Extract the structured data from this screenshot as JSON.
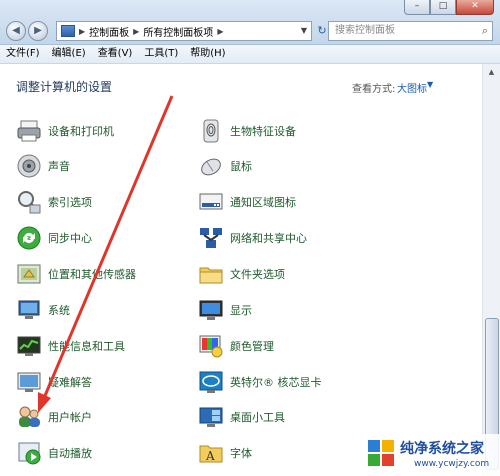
{
  "address_bar": {
    "crumbs": [
      "控制面板",
      "所有控制面板项"
    ],
    "search_placeholder": "搜索控制面板"
  },
  "window_buttons": {
    "minimize": "–",
    "maximize": "□",
    "close": "✕"
  },
  "menu": {
    "file": "文件(F)",
    "edit": "编辑(E)",
    "view": "查看(V)",
    "tools": "工具(T)",
    "help": "帮助(H)"
  },
  "header": {
    "title": "调整计算机的设置",
    "view_by_label": "查看方式:",
    "view_by_value": "大图标"
  },
  "items_left": [
    {
      "label": "设备和打印机",
      "icon": "printer-icon"
    },
    {
      "label": "声音",
      "icon": "speaker-icon"
    },
    {
      "label": "索引选项",
      "icon": "index-icon"
    },
    {
      "label": "同步中心",
      "icon": "sync-icon"
    },
    {
      "label": "位置和其他传感器",
      "icon": "sensor-icon"
    },
    {
      "label": "系统",
      "icon": "system-icon"
    },
    {
      "label": "性能信息和工具",
      "icon": "performance-icon"
    },
    {
      "label": "疑难解答",
      "icon": "troubleshoot-icon"
    },
    {
      "label": "用户帐户",
      "icon": "user-accounts-icon"
    },
    {
      "label": "自动播放",
      "icon": "autoplay-icon"
    }
  ],
  "items_right": [
    {
      "label": "生物特征设备",
      "icon": "fingerprint-icon"
    },
    {
      "label": "鼠标",
      "icon": "mouse-icon"
    },
    {
      "label": "通知区域图标",
      "icon": "notification-icon"
    },
    {
      "label": "网络和共享中心",
      "icon": "network-icon"
    },
    {
      "label": "文件夹选项",
      "icon": "folder-options-icon"
    },
    {
      "label": "显示",
      "icon": "display-icon"
    },
    {
      "label": "颜色管理",
      "icon": "color-management-icon"
    },
    {
      "label": "英特尔® 核芯显卡",
      "icon": "intel-graphics-icon"
    },
    {
      "label": "桌面小工具",
      "icon": "gadgets-icon"
    },
    {
      "label": "字体",
      "icon": "fonts-icon"
    }
  ],
  "watermark": {
    "title": "纯净系统之家",
    "url": "www.ycwjzy.com"
  },
  "colors": {
    "accent": "#1a5cb4",
    "item_text": "#1e5a2b",
    "annotation_arrow": "#e0352b"
  }
}
